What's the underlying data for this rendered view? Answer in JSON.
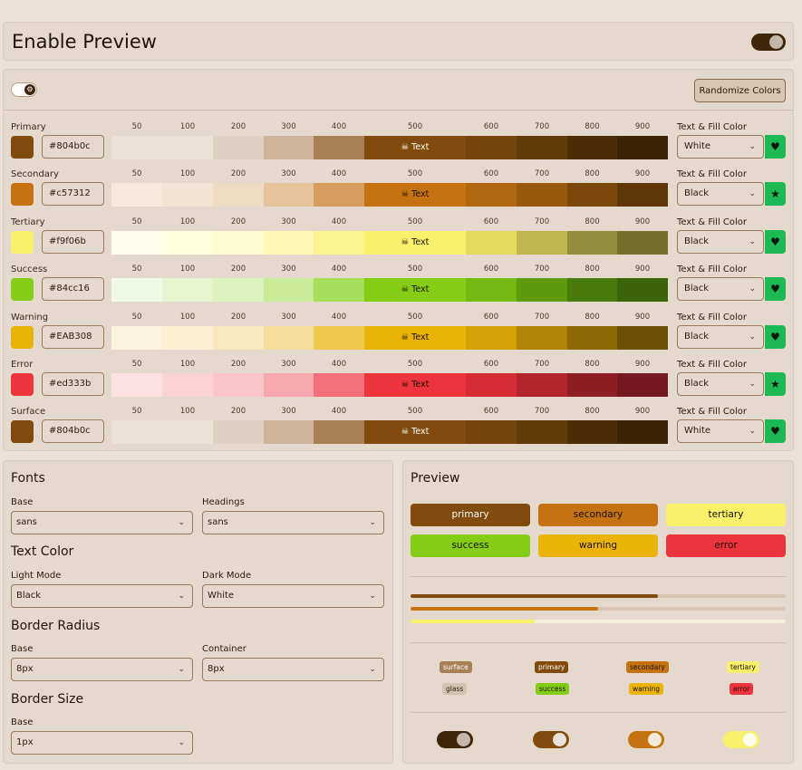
{
  "header": {
    "title": "Enable Preview"
  },
  "toolbar": {
    "randomize_label": "Randomize Colors",
    "settings_icon": "gear-icon"
  },
  "shade_labels": [
    "50",
    "100",
    "200",
    "300",
    "400",
    "500",
    "600",
    "700",
    "800",
    "900"
  ],
  "text_fill_label": "Text & Fill Color",
  "sample_text": "Text",
  "palette": [
    {
      "label": "Primary",
      "hex": "#804b0c",
      "textfill": "White",
      "btn": "heart",
      "shades": [
        "#ebe2da",
        "#eae1d9",
        "#dfd0c2",
        "#cdb49a",
        "#a97f56",
        "#804b0c",
        "#74440b",
        "#633a0a",
        "#4d2d08",
        "#3c2206"
      ]
    },
    {
      "label": "Secondary",
      "hex": "#c57312",
      "textfill": "Black",
      "btn": "star",
      "shades": [
        "#f5e9dc",
        "#f2e3d3",
        "#efdbc2",
        "#e6c39a",
        "#d79d5d",
        "#c57312",
        "#b1670f",
        "#98580d",
        "#7b470a",
        "#5e3608"
      ]
    },
    {
      "label": "Tertiary",
      "hex": "#f9f06b",
      "textfill": "Black",
      "btn": "heart",
      "shades": [
        "#fefde9",
        "#fefdde",
        "#fefcd0",
        "#fdf8b5",
        "#faf38e",
        "#f9f06b",
        "#e3da5e",
        "#bfb64e",
        "#948d3c",
        "#76702f"
      ]
    },
    {
      "label": "Success",
      "hex": "#84cc16",
      "textfill": "Black",
      "btn": "heart",
      "shades": [
        "#f0f9e3",
        "#e6f5d0",
        "#dbf1be",
        "#c9ea98",
        "#a8dc5b",
        "#84cc16",
        "#74b812",
        "#5e9a0e",
        "#4a7a0b",
        "#3d6408"
      ]
    },
    {
      "label": "Warning",
      "hex": "#EAB308",
      "textfill": "Black",
      "btn": "heart",
      "shades": [
        "#fcf4de",
        "#fbf0d1",
        "#f8e8bc",
        "#f5dd9c",
        "#f0c84f",
        "#eab308",
        "#d4a106",
        "#b08405",
        "#8b6803",
        "#6d5103"
      ]
    },
    {
      "label": "Error",
      "hex": "#ed333b",
      "textfill": "Black",
      "btn": "star",
      "shades": [
        "#fde1e2",
        "#fbd3d5",
        "#f9c5c7",
        "#f6a8ac",
        "#f1707a",
        "#ed333b",
        "#d52c35",
        "#b3242d",
        "#8f1d24",
        "#751820"
      ]
    },
    {
      "label": "Surface",
      "hex": "#804b0c",
      "textfill": "White",
      "btn": "heart",
      "shades": [
        "#ebe2da",
        "#eae1d9",
        "#dfd0c2",
        "#cdb49a",
        "#a97f56",
        "#804b0c",
        "#74440b",
        "#633a0a",
        "#4d2d08",
        "#3c2206"
      ]
    }
  ],
  "fonts": {
    "title": "Fonts",
    "base_label": "Base",
    "base_value": "sans",
    "headings_label": "Headings",
    "headings_value": "sans"
  },
  "text_color": {
    "title": "Text Color",
    "light_label": "Light Mode",
    "light_value": "Black",
    "dark_label": "Dark Mode",
    "dark_value": "White"
  },
  "border_radius": {
    "title": "Border Radius",
    "base_label": "Base",
    "base_value": "8px",
    "container_label": "Container",
    "container_value": "8px"
  },
  "border_size": {
    "title": "Border Size",
    "base_label": "Base",
    "base_value": "1px"
  },
  "preview": {
    "title": "Preview",
    "buttons": [
      "primary",
      "secondary",
      "tertiary",
      "success",
      "warning",
      "error"
    ],
    "progress": [
      {
        "value": 0.66,
        "color": "#804b0c"
      },
      {
        "value": 0.5,
        "color": "#c57312"
      },
      {
        "value": 0.33,
        "color": "#f9f06b"
      }
    ],
    "badges_row1": [
      "surface",
      "primary",
      "secondary",
      "tertiary"
    ],
    "badges_row2": [
      "glass",
      "success",
      "warning",
      "error"
    ]
  },
  "chevron_icon": "chevron-down-icon"
}
